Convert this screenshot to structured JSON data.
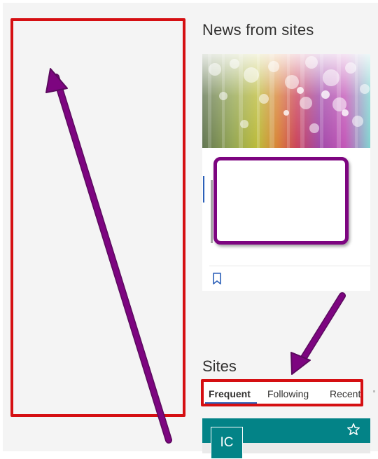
{
  "news": {
    "title": "News from sites"
  },
  "sites": {
    "title": "Sites",
    "tabs": [
      {
        "label": "Frequent",
        "selected": true
      },
      {
        "label": "Following",
        "selected": false
      },
      {
        "label": "Recent",
        "selected": false
      }
    ],
    "card": {
      "logo_text": "IC",
      "color": "#038387"
    }
  },
  "colors": {
    "highlight_red": "#d50f12",
    "annotation_purple": "#7d0580",
    "accent_blue": "#2b5fb8"
  },
  "icons": {
    "bookmark": "bookmark-icon",
    "star": "star-icon"
  }
}
